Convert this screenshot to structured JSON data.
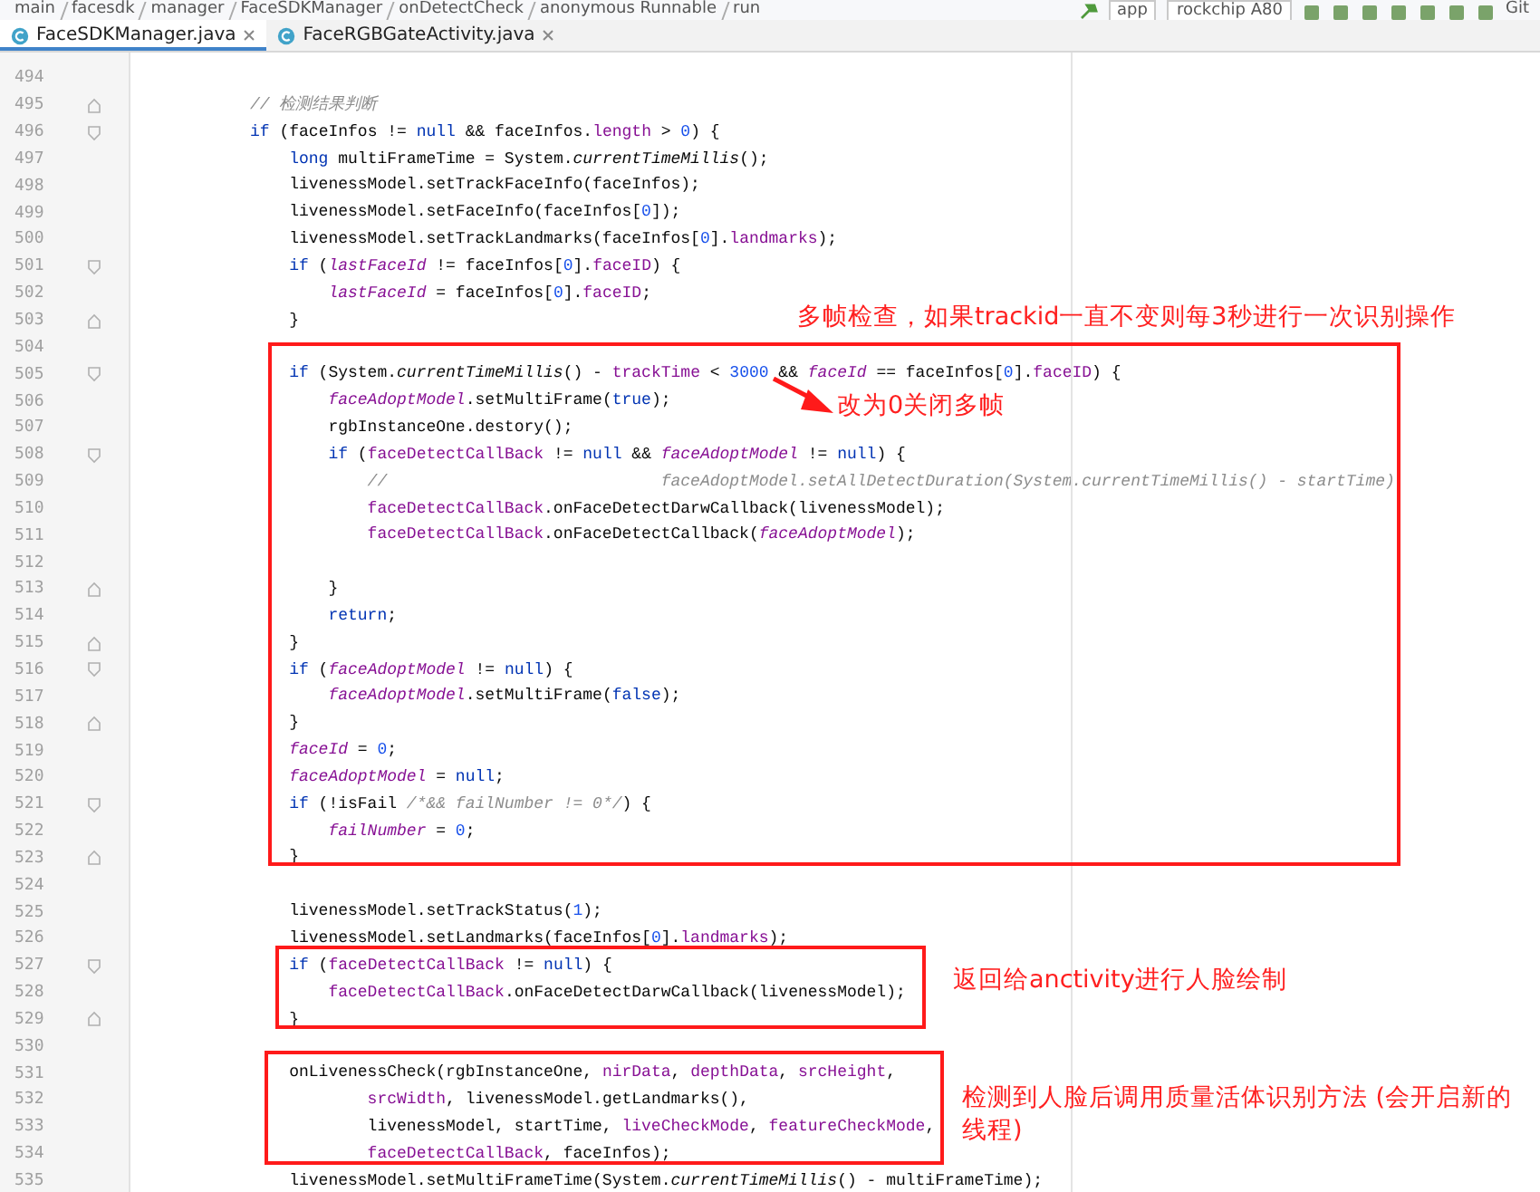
{
  "breadcrumb": [
    "main",
    "facesdk",
    "manager",
    "FaceSDKManager",
    "onDetectCheck",
    "anonymous Runnable",
    "run"
  ],
  "toolbar": {
    "module": "app",
    "device": "rockchip A80",
    "vcs": "Git"
  },
  "tabs": [
    {
      "label": "FaceSDKManager.java",
      "selected": true
    },
    {
      "label": "FaceRGBGateActivity.java",
      "selected": false
    }
  ],
  "lines": [
    {
      "number": "494",
      "kind": "plain"
    },
    {
      "number": "495",
      "kind": "fold-end",
      "tokens": [
        {
          "kind": "comment",
          "text": "// 检测结果判断"
        }
      ]
    },
    {
      "number": "496",
      "kind": "fold-start",
      "tokens": [
        {
          "kind": "keyword",
          "text": "if"
        },
        {
          "kind": "plain",
          "text": " (faceInfos != "
        },
        {
          "kind": "keyword",
          "text": "null"
        },
        {
          "kind": "plain",
          "text": " && faceInfos."
        },
        {
          "kind": "member",
          "text": "length"
        },
        {
          "kind": "plain",
          "text": " > "
        },
        {
          "kind": "number",
          "text": "0"
        },
        {
          "kind": "plain",
          "text": ") {"
        }
      ]
    },
    {
      "number": "497",
      "kind": "plain",
      "tokens": [
        {
          "kind": "keyword",
          "text": "    long"
        },
        {
          "kind": "plain",
          "text": " multiFrameTime = System."
        },
        {
          "kind": "static",
          "text": "currentTimeMillis"
        },
        {
          "kind": "plain",
          "text": "();"
        }
      ]
    },
    {
      "number": "498",
      "kind": "plain",
      "tokens": [
        {
          "kind": "plain",
          "text": "    livenessModel.setTrackFaceInfo(faceInfos);"
        }
      ]
    },
    {
      "number": "499",
      "kind": "plain",
      "tokens": [
        {
          "kind": "plain",
          "text": "    livenessModel.setFaceInfo(faceInfos["
        },
        {
          "kind": "number",
          "text": "0"
        },
        {
          "kind": "plain",
          "text": "]);"
        }
      ]
    },
    {
      "number": "500",
      "kind": "plain",
      "tokens": [
        {
          "kind": "plain",
          "text": "    livenessModel.setTrackLandmarks(faceInfos["
        },
        {
          "kind": "number",
          "text": "0"
        },
        {
          "kind": "plain",
          "text": "]."
        },
        {
          "kind": "member",
          "text": "landmarks"
        },
        {
          "kind": "plain",
          "text": ");"
        }
      ]
    },
    {
      "number": "501",
      "kind": "fold-start",
      "tokens": [
        {
          "kind": "keyword",
          "text": "    if"
        },
        {
          "kind": "plain",
          "text": " ("
        },
        {
          "kind": "field",
          "text": "lastFaceId"
        },
        {
          "kind": "plain",
          "text": " != faceInfos["
        },
        {
          "kind": "number",
          "text": "0"
        },
        {
          "kind": "plain",
          "text": "]."
        },
        {
          "kind": "member",
          "text": "faceID"
        },
        {
          "kind": "plain",
          "text": ") {"
        }
      ]
    },
    {
      "number": "502",
      "kind": "plain",
      "tokens": [
        {
          "kind": "field",
          "text": "        lastFaceId"
        },
        {
          "kind": "plain",
          "text": " = faceInfos["
        },
        {
          "kind": "number",
          "text": "0"
        },
        {
          "kind": "plain",
          "text": "]."
        },
        {
          "kind": "member",
          "text": "faceID"
        },
        {
          "kind": "plain",
          "text": ";"
        }
      ]
    },
    {
      "number": "503",
      "kind": "fold-end",
      "tokens": [
        {
          "kind": "plain",
          "text": "    }"
        }
      ]
    },
    {
      "number": "504",
      "kind": "plain"
    },
    {
      "number": "505",
      "kind": "fold-start",
      "tokens": [
        {
          "kind": "keyword",
          "text": "    if"
        },
        {
          "kind": "plain",
          "text": " (System."
        },
        {
          "kind": "static",
          "text": "currentTimeMillis"
        },
        {
          "kind": "plain",
          "text": "() - "
        },
        {
          "kind": "member",
          "text": "trackTime"
        },
        {
          "kind": "plain",
          "text": " < "
        },
        {
          "kind": "number",
          "text": "3000"
        },
        {
          "kind": "plain",
          "text": " && "
        },
        {
          "kind": "field",
          "text": "faceId"
        },
        {
          "kind": "plain",
          "text": " == faceInfos["
        },
        {
          "kind": "number",
          "text": "0"
        },
        {
          "kind": "plain",
          "text": "]."
        },
        {
          "kind": "member",
          "text": "faceID"
        },
        {
          "kind": "plain",
          "text": ") {"
        }
      ]
    },
    {
      "number": "506",
      "kind": "plain",
      "tokens": [
        {
          "kind": "field",
          "text": "        faceAdoptModel"
        },
        {
          "kind": "plain",
          "text": ".setMultiFrame("
        },
        {
          "kind": "keyword",
          "text": "true"
        },
        {
          "kind": "plain",
          "text": ");"
        }
      ]
    },
    {
      "number": "507",
      "kind": "plain",
      "tokens": [
        {
          "kind": "plain",
          "text": "        rgbInstanceOne.destory();"
        }
      ]
    },
    {
      "number": "508",
      "kind": "fold-start",
      "tokens": [
        {
          "kind": "keyword",
          "text": "        if"
        },
        {
          "kind": "plain",
          "text": " ("
        },
        {
          "kind": "member",
          "text": "faceDetectCallBack"
        },
        {
          "kind": "plain",
          "text": " != "
        },
        {
          "kind": "keyword",
          "text": "null"
        },
        {
          "kind": "plain",
          "text": " && "
        },
        {
          "kind": "field",
          "text": "faceAdoptModel"
        },
        {
          "kind": "plain",
          "text": " != "
        },
        {
          "kind": "keyword",
          "text": "null"
        },
        {
          "kind": "plain",
          "text": ") {"
        }
      ]
    },
    {
      "number": "509",
      "kind": "plain",
      "tokens": [
        {
          "kind": "comment",
          "text": "            //                            faceAdoptModel.setAllDetectDuration(System.currentTimeMillis() - startTime)"
        }
      ]
    },
    {
      "number": "510",
      "kind": "plain",
      "tokens": [
        {
          "kind": "member",
          "text": "            faceDetectCallBack"
        },
        {
          "kind": "plain",
          "text": ".onFaceDetectDarwCallback(livenessModel);"
        }
      ]
    },
    {
      "number": "511",
      "kind": "plain",
      "tokens": [
        {
          "kind": "member",
          "text": "            faceDetectCallBack"
        },
        {
          "kind": "plain",
          "text": ".onFaceDetectCallback("
        },
        {
          "kind": "field",
          "text": "faceAdoptModel"
        },
        {
          "kind": "plain",
          "text": ");"
        }
      ]
    },
    {
      "number": "512",
      "kind": "plain"
    },
    {
      "number": "513",
      "kind": "fold-end",
      "tokens": [
        {
          "kind": "plain",
          "text": "        }"
        }
      ]
    },
    {
      "number": "514",
      "kind": "plain",
      "tokens": [
        {
          "kind": "keyword",
          "text": "        return"
        },
        {
          "kind": "plain",
          "text": ";"
        }
      ]
    },
    {
      "number": "515",
      "kind": "fold-end",
      "tokens": [
        {
          "kind": "plain",
          "text": "    }"
        }
      ]
    },
    {
      "number": "516",
      "kind": "fold-start",
      "tokens": [
        {
          "kind": "keyword",
          "text": "    if"
        },
        {
          "kind": "plain",
          "text": " ("
        },
        {
          "kind": "field",
          "text": "faceAdoptModel"
        },
        {
          "kind": "plain",
          "text": " != "
        },
        {
          "kind": "keyword",
          "text": "null"
        },
        {
          "kind": "plain",
          "text": ") {"
        }
      ]
    },
    {
      "number": "517",
      "kind": "plain",
      "tokens": [
        {
          "kind": "field",
          "text": "        faceAdoptModel"
        },
        {
          "kind": "plain",
          "text": ".setMultiFrame("
        },
        {
          "kind": "keyword",
          "text": "false"
        },
        {
          "kind": "plain",
          "text": ");"
        }
      ]
    },
    {
      "number": "518",
      "kind": "fold-end",
      "tokens": [
        {
          "kind": "plain",
          "text": "    }"
        }
      ]
    },
    {
      "number": "519",
      "kind": "plain",
      "tokens": [
        {
          "kind": "field",
          "text": "    faceId"
        },
        {
          "kind": "plain",
          "text": " = "
        },
        {
          "kind": "number",
          "text": "0"
        },
        {
          "kind": "plain",
          "text": ";"
        }
      ]
    },
    {
      "number": "520",
      "kind": "plain",
      "tokens": [
        {
          "kind": "field",
          "text": "    faceAdoptModel"
        },
        {
          "kind": "plain",
          "text": " = "
        },
        {
          "kind": "keyword",
          "text": "null"
        },
        {
          "kind": "plain",
          "text": ";"
        }
      ]
    },
    {
      "number": "521",
      "kind": "fold-start",
      "tokens": [
        {
          "kind": "keyword",
          "text": "    if"
        },
        {
          "kind": "plain",
          "text": " (!isFail "
        },
        {
          "kind": "comment",
          "text": "/*&& failNumber != 0*/"
        },
        {
          "kind": "plain",
          "text": ") {"
        }
      ]
    },
    {
      "number": "522",
      "kind": "plain",
      "tokens": [
        {
          "kind": "field",
          "text": "        failNumber"
        },
        {
          "kind": "plain",
          "text": " = "
        },
        {
          "kind": "number",
          "text": "0"
        },
        {
          "kind": "plain",
          "text": ";"
        }
      ]
    },
    {
      "number": "523",
      "kind": "fold-end",
      "tokens": [
        {
          "kind": "plain",
          "text": "    }"
        }
      ]
    },
    {
      "number": "524",
      "kind": "plain"
    },
    {
      "number": "525",
      "kind": "plain",
      "tokens": [
        {
          "kind": "plain",
          "text": "    livenessModel.setTrackStatus("
        },
        {
          "kind": "number",
          "text": "1"
        },
        {
          "kind": "plain",
          "text": ");"
        }
      ]
    },
    {
      "number": "526",
      "kind": "plain",
      "tokens": [
        {
          "kind": "plain",
          "text": "    livenessModel.setLandmarks(faceInfos["
        },
        {
          "kind": "number",
          "text": "0"
        },
        {
          "kind": "plain",
          "text": "]."
        },
        {
          "kind": "member",
          "text": "landmarks"
        },
        {
          "kind": "plain",
          "text": ");"
        }
      ]
    },
    {
      "number": "527",
      "kind": "fold-start",
      "tokens": [
        {
          "kind": "keyword",
          "text": "    if"
        },
        {
          "kind": "plain",
          "text": " ("
        },
        {
          "kind": "member",
          "text": "faceDetectCallBack"
        },
        {
          "kind": "plain",
          "text": " != "
        },
        {
          "kind": "keyword",
          "text": "null"
        },
        {
          "kind": "plain",
          "text": ") {"
        }
      ]
    },
    {
      "number": "528",
      "kind": "plain",
      "tokens": [
        {
          "kind": "member",
          "text": "        faceDetectCallBack"
        },
        {
          "kind": "plain",
          "text": ".onFaceDetectDarwCallback(livenessModel);"
        }
      ]
    },
    {
      "number": "529",
      "kind": "fold-end",
      "tokens": [
        {
          "kind": "plain",
          "text": "    }"
        }
      ]
    },
    {
      "number": "530",
      "kind": "plain"
    },
    {
      "number": "531",
      "kind": "plain",
      "tokens": [
        {
          "kind": "plain",
          "text": "    onLivenessCheck(rgbInstanceOne, "
        },
        {
          "kind": "member",
          "text": "nirData"
        },
        {
          "kind": "plain",
          "text": ", "
        },
        {
          "kind": "member",
          "text": "depthData"
        },
        {
          "kind": "plain",
          "text": ", "
        },
        {
          "kind": "member",
          "text": "srcHeight"
        },
        {
          "kind": "plain",
          "text": ","
        }
      ]
    },
    {
      "number": "532",
      "kind": "plain",
      "tokens": [
        {
          "kind": "member",
          "text": "            srcWidth"
        },
        {
          "kind": "plain",
          "text": ", livenessModel.getLandmarks(),"
        }
      ]
    },
    {
      "number": "533",
      "kind": "plain",
      "tokens": [
        {
          "kind": "plain",
          "text": "            livenessModel, startTime, "
        },
        {
          "kind": "member",
          "text": "liveCheckMode"
        },
        {
          "kind": "plain",
          "text": ", "
        },
        {
          "kind": "member",
          "text": "featureCheckMode"
        },
        {
          "kind": "plain",
          "text": ","
        }
      ]
    },
    {
      "number": "534",
      "kind": "plain",
      "tokens": [
        {
          "kind": "member",
          "text": "            faceDetectCallBack"
        },
        {
          "kind": "plain",
          "text": ", faceInfos);"
        }
      ]
    },
    {
      "number": "535",
      "kind": "plain",
      "tokens": [
        {
          "kind": "plain",
          "text": "    livenessModel.setMultiFrameTime(System."
        },
        {
          "kind": "static",
          "text": "currentTimeMillis"
        },
        {
          "kind": "plain",
          "text": "() - multiFrameTime);"
        }
      ]
    }
  ],
  "notes": [
    "多帧检查，如果trackid一直不变则每3秒进行一次识别操作",
    "改为0关闭多帧",
    "返回给anctivity进行人脸绘制",
    "检测到人脸后调用质量活体识别方法 (会开启新的线程)"
  ]
}
